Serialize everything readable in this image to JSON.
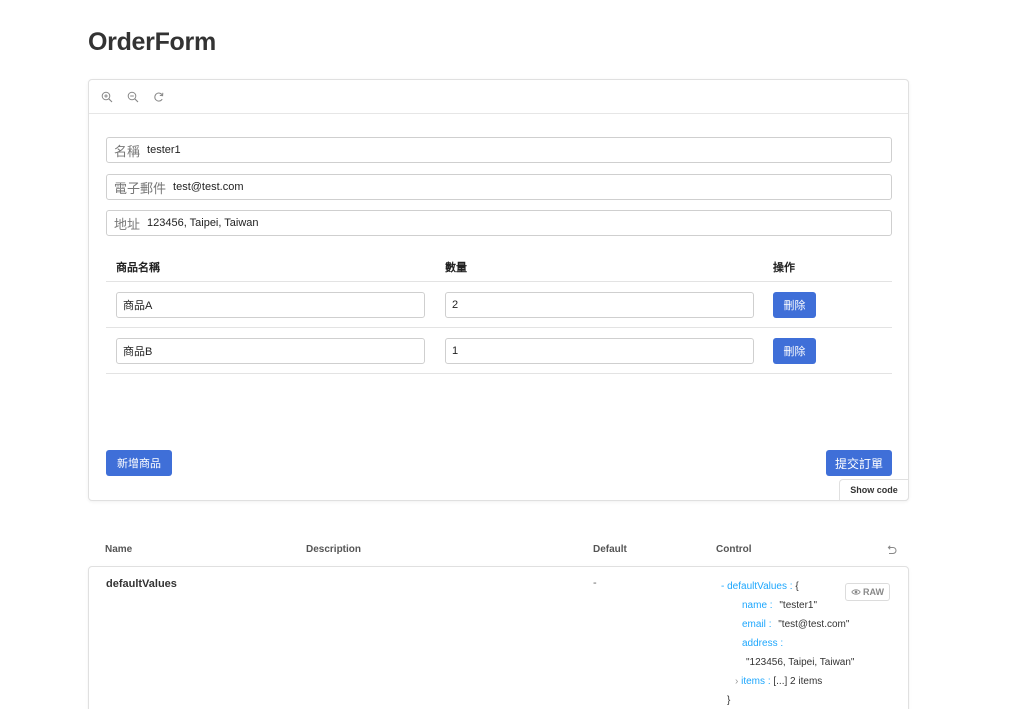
{
  "page": {
    "title": "OrderForm"
  },
  "toolbar": {
    "icons": [
      "zoom-in-icon",
      "zoom-out-icon",
      "reset-zoom-icon"
    ]
  },
  "form": {
    "name": {
      "label": "名稱",
      "value": "tester1"
    },
    "email": {
      "label": "電子郵件",
      "value": "test@test.com"
    },
    "address": {
      "label": "地址",
      "value": "123456, Taipei, Taiwan"
    },
    "columns": {
      "product": "商品名稱",
      "quantity": "數量",
      "action": "操作"
    },
    "items": [
      {
        "product": "商品A",
        "quantity": "2",
        "delete_label": "刪除"
      },
      {
        "product": "商品B",
        "quantity": "1",
        "delete_label": "刪除"
      }
    ],
    "add_label": "新增商品",
    "submit_label": "提交訂單"
  },
  "show_code_label": "Show code",
  "args": {
    "headers": {
      "name": "Name",
      "description": "Description",
      "default": "Default",
      "control": "Control"
    },
    "row": {
      "name": "defaultValues",
      "default": "-"
    },
    "raw_label": "RAW",
    "control": {
      "prefix": "-",
      "root_key": "defaultValues",
      "root_open": "{",
      "name_key": "name",
      "name_value": "\"tester1\"",
      "email_key": "email",
      "email_value": "\"test@test.com\"",
      "address_key": "address",
      "address_value": "\"123456, Taipei, Taiwan\"",
      "items_arrow": "›",
      "items_key": "items",
      "items_value": "[...] 2 items",
      "root_close": "}",
      "colon": ":"
    }
  },
  "colors": {
    "primary": "#3f6fd8",
    "json_key": "#1ea7fd",
    "border": "#e0e0e0"
  }
}
